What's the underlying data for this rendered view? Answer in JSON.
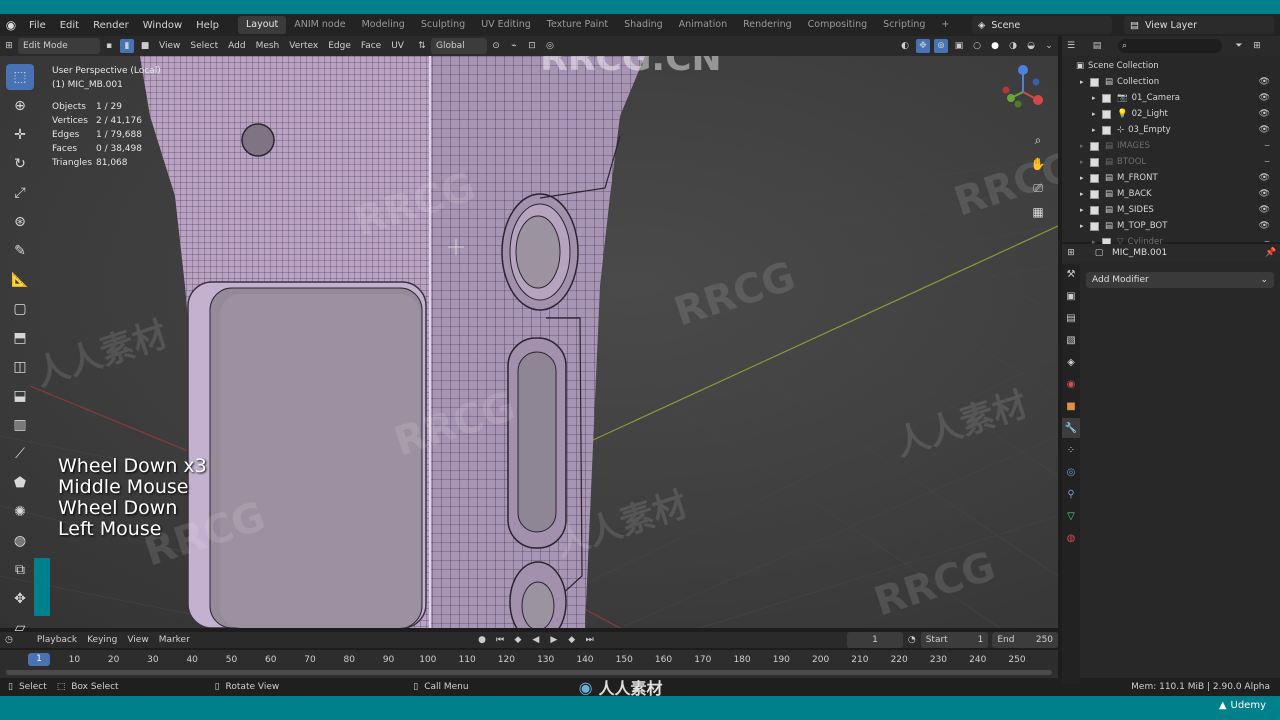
{
  "menu": [
    "File",
    "Edit",
    "Render",
    "Window",
    "Help"
  ],
  "workspaces": [
    "Layout",
    "ANIM node",
    "Modeling",
    "Sculpting",
    "UV Editing",
    "Texture Paint",
    "Shading",
    "Animation",
    "Rendering",
    "Compositing",
    "Scripting"
  ],
  "active_workspace": "Layout",
  "scene": "Scene",
  "view_layer": "View Layer",
  "header": {
    "mode": "Edit Mode",
    "menus": [
      "View",
      "Select",
      "Add",
      "Mesh",
      "Vertex",
      "Edge",
      "Face",
      "UV"
    ],
    "orientation": "Global"
  },
  "viewport": {
    "perspective": "User Perspective (Local)",
    "object": "(1) MIC_MB.001",
    "stats": [
      {
        "label": "Objects",
        "value": "1 / 29"
      },
      {
        "label": "Vertices",
        "value": "2 / 41,176"
      },
      {
        "label": "Edges",
        "value": "1 / 79,688"
      },
      {
        "label": "Faces",
        "value": "0 / 38,498"
      },
      {
        "label": "Triangles",
        "value": "81,068"
      }
    ],
    "key_overlay": [
      "Wheel Down x3",
      "Middle Mouse",
      "Wheel Down",
      "Left Mouse"
    ]
  },
  "timeline": {
    "menus": [
      "Playback",
      "Keying",
      "View",
      "Marker"
    ],
    "current_frame": "1",
    "start_label": "Start",
    "start": "1",
    "end_label": "End",
    "end": "250",
    "frames": [
      "1",
      "10",
      "20",
      "30",
      "40",
      "50",
      "60",
      "70",
      "80",
      "90",
      "100",
      "110",
      "120",
      "130",
      "140",
      "150",
      "160",
      "170",
      "180",
      "190",
      "200",
      "210",
      "220",
      "230",
      "240",
      "250"
    ]
  },
  "outliner": {
    "root": "Scene Collection",
    "items": [
      {
        "name": "Collection",
        "dim": false
      },
      {
        "name": "01_Camera",
        "dim": false
      },
      {
        "name": "02_Light",
        "dim": false
      },
      {
        "name": "03_Empty",
        "dim": false
      },
      {
        "name": "IMAGES",
        "dim": true
      },
      {
        "name": "BTOOL",
        "dim": true
      },
      {
        "name": "M_FRONT",
        "dim": false
      },
      {
        "name": "M_BACK",
        "dim": false
      },
      {
        "name": "M_SIDES",
        "dim": false
      },
      {
        "name": "M_TOP_BOT",
        "dim": false
      },
      {
        "name": "Cylinder",
        "dim": true
      }
    ]
  },
  "properties": {
    "object": "MIC_MB.001",
    "add_modifier": "Add Modifier"
  },
  "status": {
    "select": "Select",
    "box_select": "Box Select",
    "rotate_view": "Rotate View",
    "call_menu": "Call Menu",
    "memory": "Mem: 110.1 MiB | 2.90.0 Alpha",
    "brand": "Udemy"
  },
  "watermarks": {
    "rrcg": "RRCG",
    "rrcg_cn": "RRCG.CN",
    "cn_brand": "人人素材"
  },
  "colors": {
    "accent": "#4772b3",
    "teal": "#00808a",
    "mesh": "#b9a2c3"
  }
}
